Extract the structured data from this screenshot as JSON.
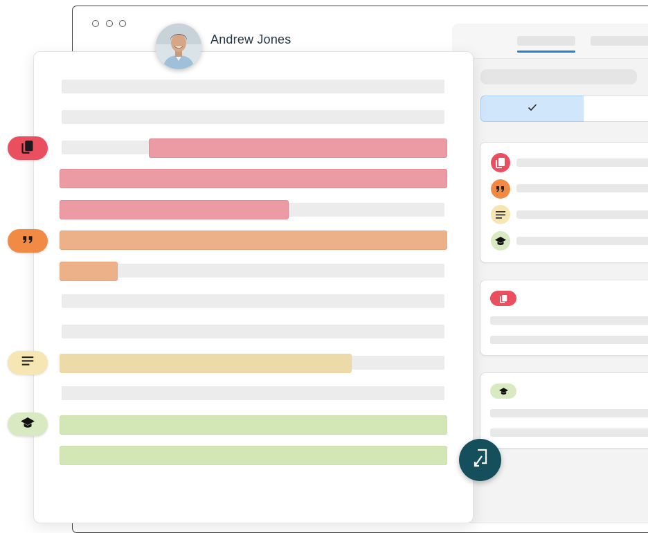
{
  "user": {
    "name": "Andrew Jones"
  },
  "colors": {
    "red": "#ea4f5f",
    "orange": "#f08a45",
    "yellow": "#f6e6b3",
    "green": "#d9eac3",
    "accent_blue": "#1f7ed6",
    "fab": "#164f5c"
  },
  "annotation_markers": [
    {
      "category": "red",
      "icon": "documents-icon"
    },
    {
      "category": "orange",
      "icon": "quote-icon"
    },
    {
      "category": "yellow",
      "icon": "text-lines-icon"
    },
    {
      "category": "green",
      "icon": "graduation-cap-icon"
    }
  ],
  "right_panel": {
    "filter_selected_icon": "checkmark-icon",
    "legend_icons": [
      "documents-icon",
      "quote-icon",
      "text-lines-icon",
      "graduation-cap-icon"
    ]
  },
  "fab_icon": "export-arrow-icon"
}
